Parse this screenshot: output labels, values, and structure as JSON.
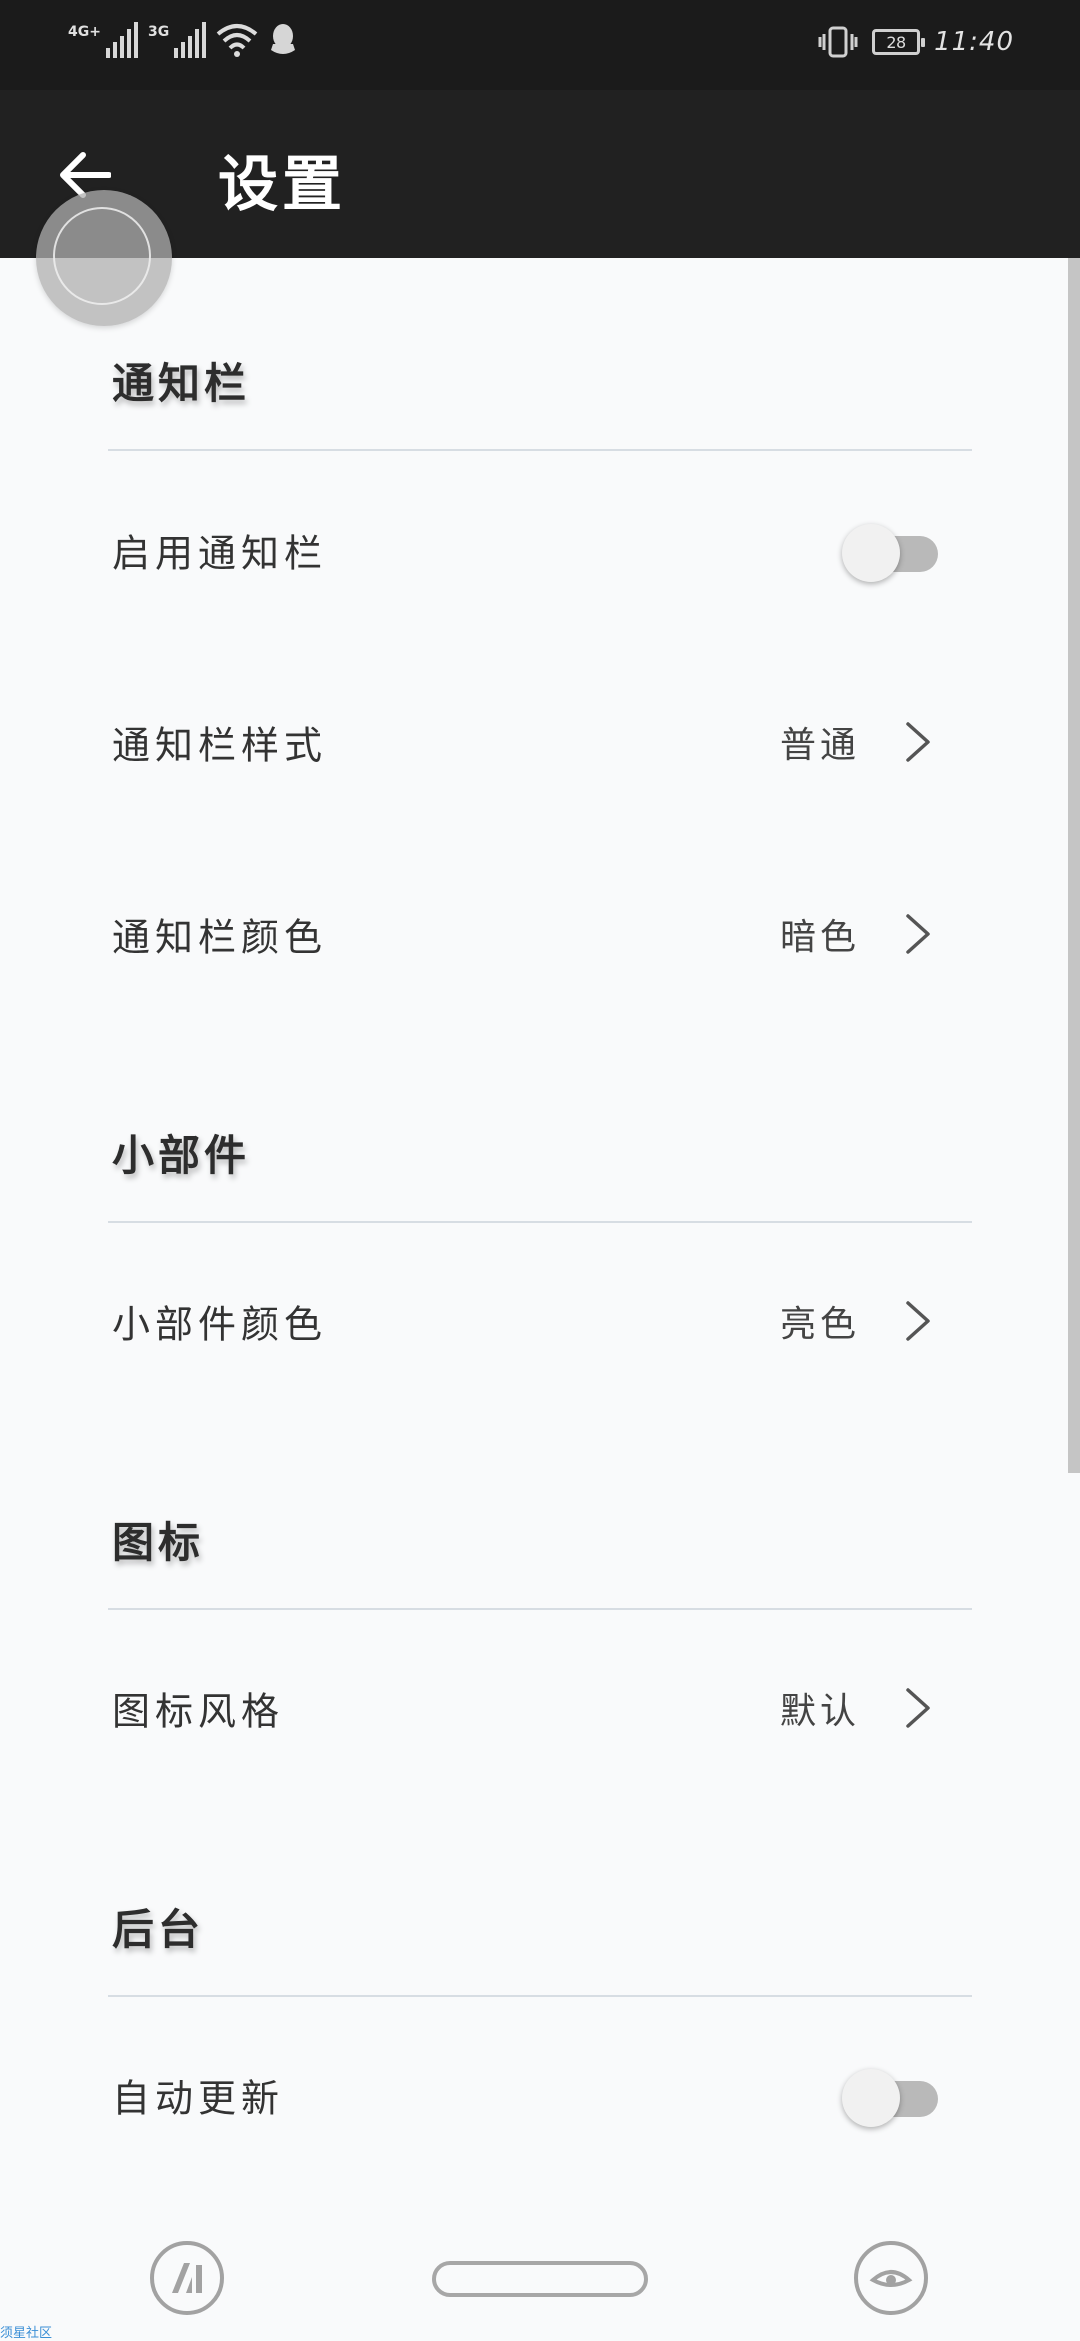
{
  "status_bar": {
    "network_1": "4G+",
    "network_2": "3G",
    "battery_level": "28",
    "time": "11:40",
    "icons": [
      "signal-icon",
      "signal-icon",
      "wifi-icon",
      "qq-icon",
      "vibrate-icon",
      "battery-icon"
    ]
  },
  "app_bar": {
    "title": "设置",
    "back_icon": "arrow-left-icon"
  },
  "sections": {
    "notification": {
      "header": "通知栏",
      "enable_label": "启用通知栏",
      "enable_state": "off",
      "style_label": "通知栏样式",
      "style_value": "普通",
      "color_label": "通知栏颜色",
      "color_value": "暗色"
    },
    "widget": {
      "header": "小部件",
      "color_label": "小部件颜色",
      "color_value": "亮色"
    },
    "icon": {
      "header": "图标",
      "style_label": "图标风格",
      "style_value": "默认"
    },
    "background": {
      "header": "后台",
      "auto_update_label": "自动更新",
      "auto_update_state": "off"
    }
  },
  "nav_bar": {
    "left_icon": "app-logo-icon",
    "center_icon": "home-pill-icon",
    "right_icon": "eye-icon"
  },
  "watermark": "须星社区",
  "colors": {
    "status_bar_bg": "#1b1b1b",
    "app_bar_bg": "#212121",
    "page_bg": "#f9fafb",
    "divider": "#d7dde3",
    "toggle_track_off": "#b9b9b9"
  }
}
